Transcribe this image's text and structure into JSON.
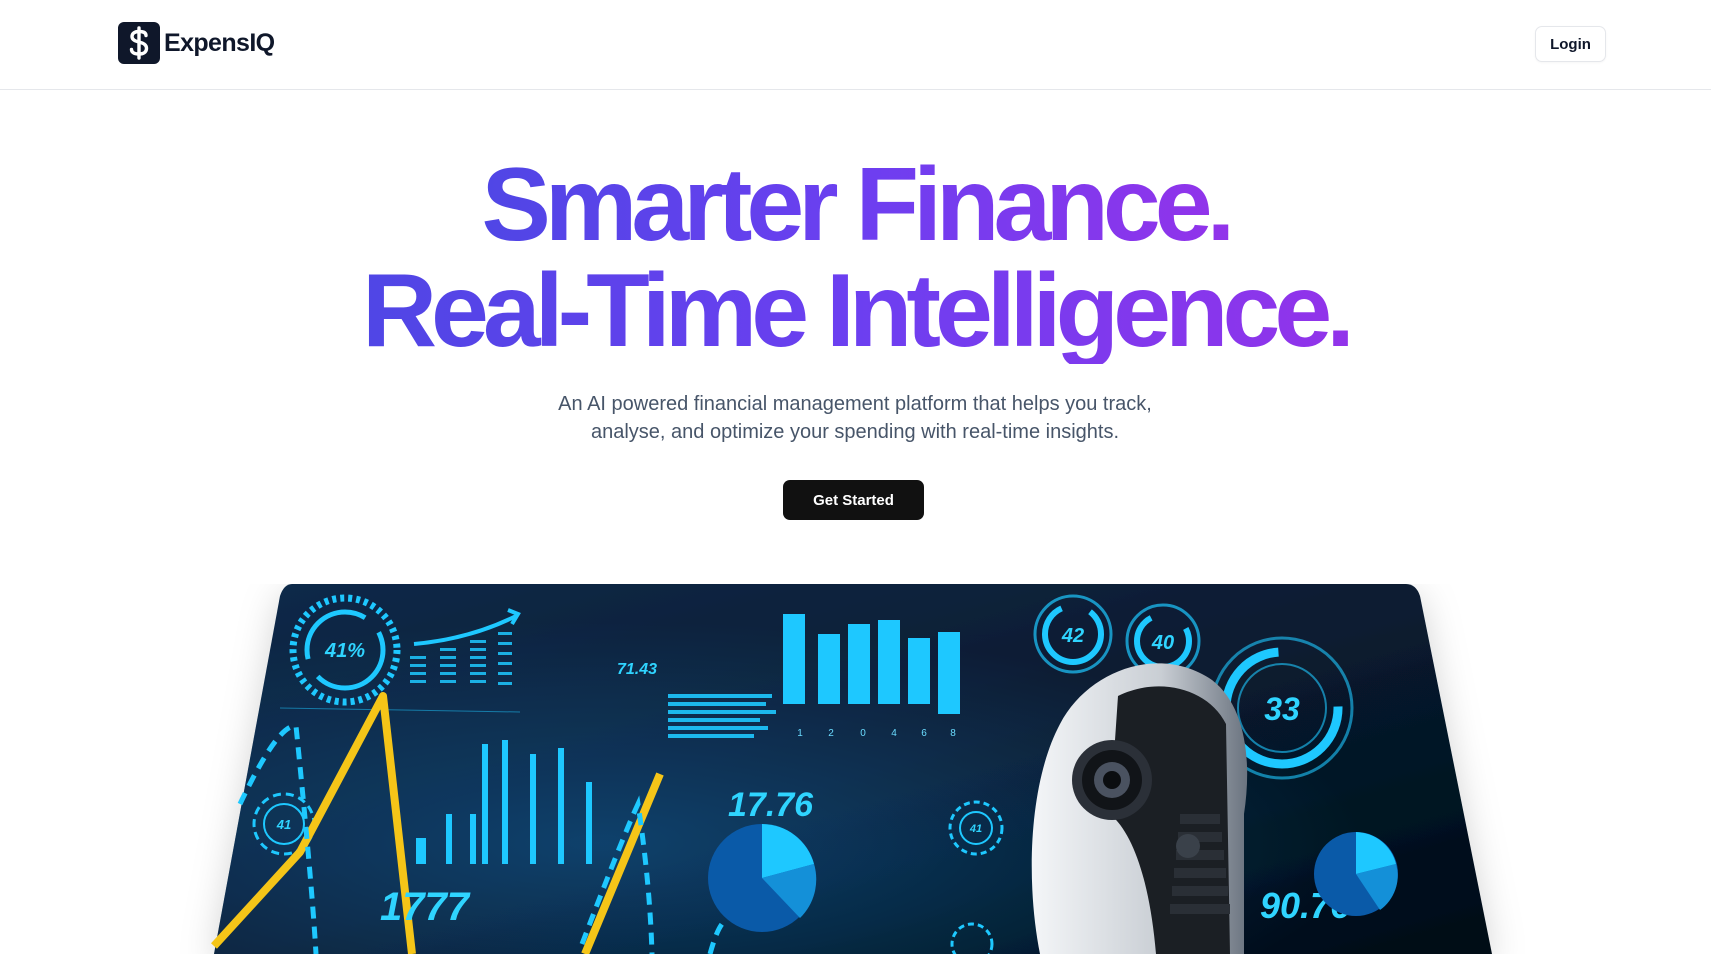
{
  "header": {
    "logo_text": "ExpensIQ",
    "logo_icon": "dollar-sign-icon",
    "login_label": "Login"
  },
  "hero": {
    "title_line_1": "Smarter Finance.",
    "title_line_2": "Real-Time Intelligence.",
    "subtitle_line_1": "An AI powered financial management platform that helps you track,",
    "subtitle_line_2": "analyse, and optimize your spending with real-time insights.",
    "cta_label": "Get Started",
    "gradient_start": "#4f46e5",
    "gradient_end": "#9333ea"
  },
  "dashboard_image": {
    "readouts": {
      "gauge_left": "41%",
      "value_a": "71.43",
      "ring_1": "42",
      "ring_2": "40",
      "ring_3": "33",
      "small_ring_left": "41",
      "small_ring_mid": "41",
      "value_b": "17.76",
      "value_c": "1777",
      "value_d": "90.76"
    },
    "bar_axis_labels": [
      "1",
      "2",
      "0",
      "4",
      "6",
      "8"
    ],
    "background_color": "#071a2e",
    "accent_color": "#2fd4ff",
    "line_color": "#f5c518"
  }
}
